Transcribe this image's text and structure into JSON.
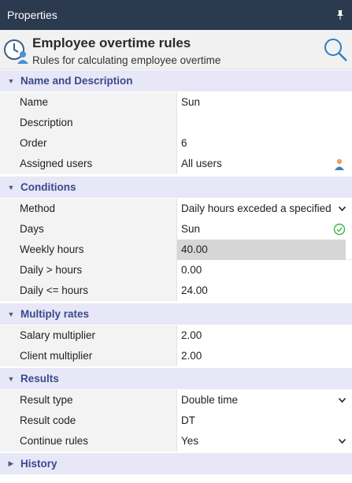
{
  "panel": {
    "title": "Properties"
  },
  "header": {
    "title": "Employee overtime rules",
    "subtitle": "Rules for calculating employee overtime"
  },
  "sections": {
    "name_desc": {
      "label": "Name and Description",
      "expanded": true
    },
    "conditions": {
      "label": "Conditions",
      "expanded": true
    },
    "multiply": {
      "label": "Multiply rates",
      "expanded": true
    },
    "results": {
      "label": "Results",
      "expanded": true
    },
    "history": {
      "label": "History",
      "expanded": false
    }
  },
  "fields": {
    "name": {
      "label": "Name",
      "value": "Sun"
    },
    "description": {
      "label": "Description",
      "value": ""
    },
    "order": {
      "label": "Order",
      "value": "6"
    },
    "assigned_users": {
      "label": "Assigned users",
      "value": "All users",
      "icon": "user-icon"
    },
    "method": {
      "label": "Method",
      "value": "Daily hours exceded a specified"
    },
    "days": {
      "label": "Days",
      "value": "Sun",
      "icon": "check-circle-icon"
    },
    "weekly_hours": {
      "label": "Weekly hours",
      "value": "40.00"
    },
    "daily_gt": {
      "label": "Daily > hours",
      "value": "0.00"
    },
    "daily_lte": {
      "label": "Daily <= hours",
      "value": "24.00"
    },
    "salary_mult": {
      "label": "Salary multiplier",
      "value": "2.00"
    },
    "client_mult": {
      "label": "Client multiplier",
      "value": "2.00"
    },
    "result_type": {
      "label": "Result type",
      "value": "Double time"
    },
    "result_code": {
      "label": "Result code",
      "value": "DT"
    },
    "continue_rules": {
      "label": "Continue rules",
      "value": "Yes"
    }
  },
  "colors": {
    "titlebar": "#2b3a4f",
    "section_bg": "#e7e7f7",
    "section_text": "#3a4a8c",
    "check": "#3cb44b"
  }
}
